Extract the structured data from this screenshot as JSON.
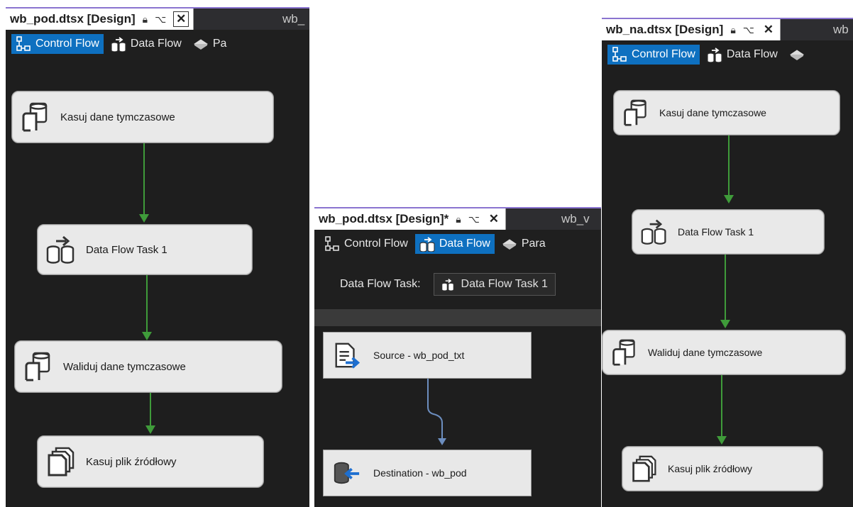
{
  "panel_left": {
    "tab_title": "wb_pod.dtsx [Design]",
    "tab_next": "wb_",
    "toolbar": {
      "control_flow": "Control Flow",
      "data_flow": "Data Flow",
      "parameters": "Pa"
    },
    "tasks": [
      {
        "label": "Kasuj dane tymczasowe",
        "icon": "sql-task-icon"
      },
      {
        "label": "Data Flow Task 1",
        "icon": "data-flow-task-icon"
      },
      {
        "label": "Waliduj dane tymczasowe",
        "icon": "sql-task-icon"
      },
      {
        "label": "Kasuj plik źródłowy",
        "icon": "file-system-task-icon"
      }
    ]
  },
  "panel_middle": {
    "tab_title": "wb_pod.dtsx [Design]*",
    "tab_next": "wb_v",
    "toolbar": {
      "control_flow": "Control Flow",
      "data_flow": "Data Flow",
      "parameters": "Para"
    },
    "data_flow_task_label": "Data Flow Task:",
    "data_flow_task_value": "Data Flow Task 1",
    "components": [
      {
        "label": "Source - wb_pod_txt",
        "icon": "flat-file-source-icon"
      },
      {
        "label": "Destination - wb_pod",
        "icon": "ole-db-destination-icon"
      }
    ]
  },
  "panel_right": {
    "tab_title": "wb_na.dtsx [Design]",
    "tab_next": "wb",
    "toolbar": {
      "control_flow": "Control Flow",
      "data_flow": "Data Flow",
      "parameters": ""
    },
    "tasks": [
      {
        "label": "Kasuj dane tymczasowe",
        "icon": "sql-task-icon"
      },
      {
        "label": "Data Flow Task 1",
        "icon": "data-flow-task-icon"
      },
      {
        "label": "Waliduj dane tymczasowe",
        "icon": "sql-task-icon"
      },
      {
        "label": "Kasuj plik źródłowy",
        "icon": "file-system-task-icon"
      }
    ]
  },
  "colors": {
    "accent": "#0e70c0",
    "precedence": "#3f9b3a",
    "data_path": "#6c8ebf",
    "tab_indicator": "#8a74d0"
  }
}
